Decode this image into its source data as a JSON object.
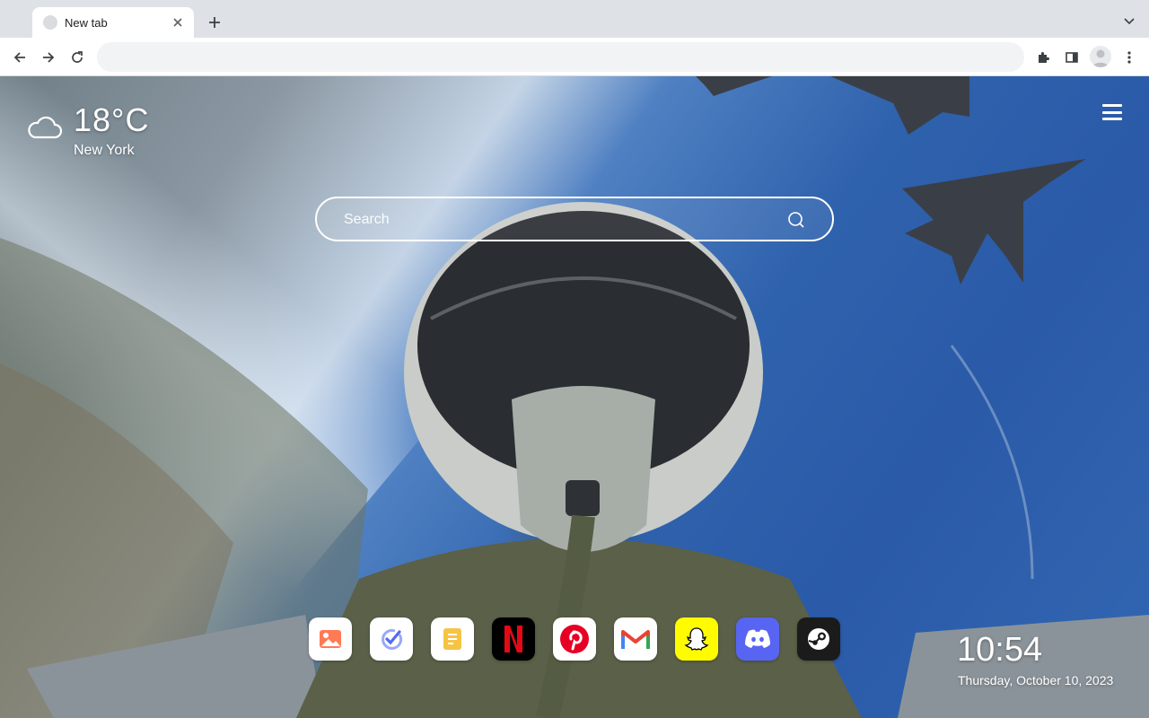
{
  "browser": {
    "tab": {
      "title": "New tab"
    },
    "omnibox": {
      "value": "",
      "placeholder": ""
    }
  },
  "newtab": {
    "weather": {
      "temperature": "18°C",
      "city": "New York",
      "icon": "cloud-icon"
    },
    "search": {
      "placeholder": "Search"
    },
    "apps": [
      {
        "name": "Gallery",
        "icon": "image-icon",
        "color": "#ff6f4b"
      },
      {
        "name": "Tasks",
        "icon": "check-icon",
        "color": "#4e6bf2"
      },
      {
        "name": "Notes",
        "icon": "notes-icon",
        "color": "#f2b705"
      },
      {
        "name": "Netflix",
        "icon": "netflix-icon",
        "color": "#e50914"
      },
      {
        "name": "Pinterest",
        "icon": "pinterest-icon",
        "color": "#e60023"
      },
      {
        "name": "Gmail",
        "icon": "gmail-icon",
        "color": "#ea4335"
      },
      {
        "name": "Snapchat",
        "icon": "snapchat-icon",
        "color": "#fffc00"
      },
      {
        "name": "Discord",
        "icon": "discord-icon",
        "color": "#5865f2"
      },
      {
        "name": "Steam",
        "icon": "steam-icon",
        "color": "#1b1b1b"
      }
    ],
    "clock": {
      "time": "10:54",
      "date": "Thursday, October 10, 2023"
    }
  }
}
